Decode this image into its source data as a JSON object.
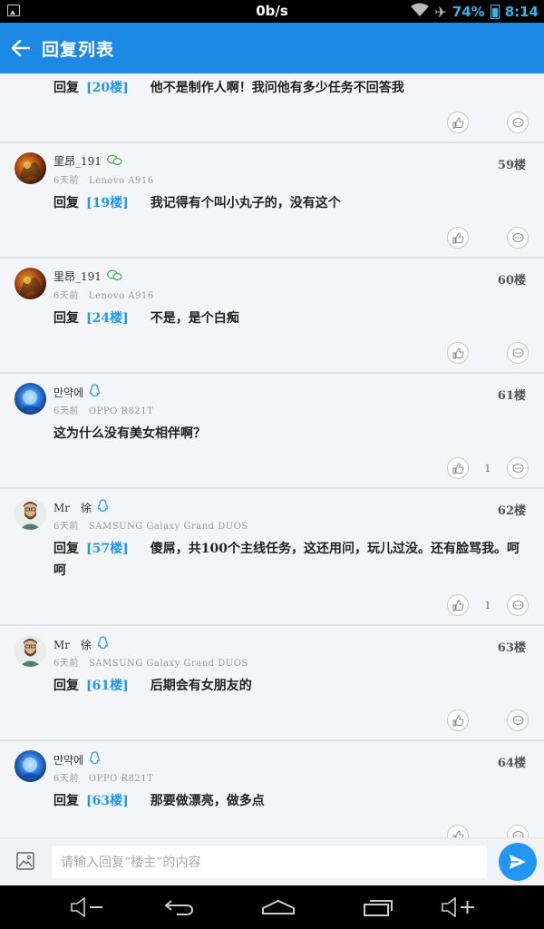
{
  "status_bar": {
    "speed": "0b/s",
    "battery": "74%",
    "time": "8:14"
  },
  "header": {
    "title": "回复列表"
  },
  "posts": [
    {
      "text_reply": "回复",
      "reply_ref": "[20楼]",
      "text": "他不是制作人啊！我问他有多少任务不回答我",
      "likes": ""
    },
    {
      "user": "里昂_191",
      "badge": "wechat",
      "time": "6天前",
      "device": "Lenovo  A916",
      "floor": "59楼",
      "text_reply": "回复",
      "reply_ref": "[19楼]",
      "text": "我记得有个叫小丸子的，没有这个",
      "likes": ""
    },
    {
      "user": "里昂_191",
      "badge": "wechat",
      "time": "6天前",
      "device": "Lenovo  A916",
      "floor": "60楼",
      "text_reply": "回复",
      "reply_ref": "[24楼]",
      "text": "不是，是个白痴",
      "likes": ""
    },
    {
      "user": "만약에",
      "badge": "qq",
      "time": "6天前",
      "device": "OPPO  R821T",
      "floor": "61楼",
      "text_reply": "",
      "reply_ref": "",
      "text": "这为什么没有美女相伴啊？",
      "likes": "1"
    },
    {
      "user": "Mr　徐",
      "badge": "qq",
      "time": "6天前",
      "device": "SAMSUNG  Galaxy  Grand  DUOS",
      "floor": "62楼",
      "text_reply": "回复",
      "reply_ref": "[57楼]",
      "text": "傻屌，共100个主线任务，这还用问，玩儿过没。还有脸骂我。呵呵",
      "likes": "1"
    },
    {
      "user": "Mr　徐",
      "badge": "qq",
      "time": "6天前",
      "device": "SAMSUNG  Galaxy  Grand  DUOS",
      "floor": "63楼",
      "text_reply": "回复",
      "reply_ref": "[61楼]",
      "text": "后期会有女朋友的",
      "likes": ""
    },
    {
      "user": "만약에",
      "badge": "qq",
      "time": "6天前",
      "device": "OPPO  R821T",
      "floor": "64楼",
      "text_reply": "回复",
      "reply_ref": "[63楼]",
      "text": "那要做漂亮，做多点",
      "likes": ""
    }
  ],
  "input": {
    "placeholder": "请输入回复“楼主”的内容"
  },
  "colors": {
    "accent": "#1e88e5",
    "link": "#2196f3",
    "background": "#f4f5f9"
  }
}
